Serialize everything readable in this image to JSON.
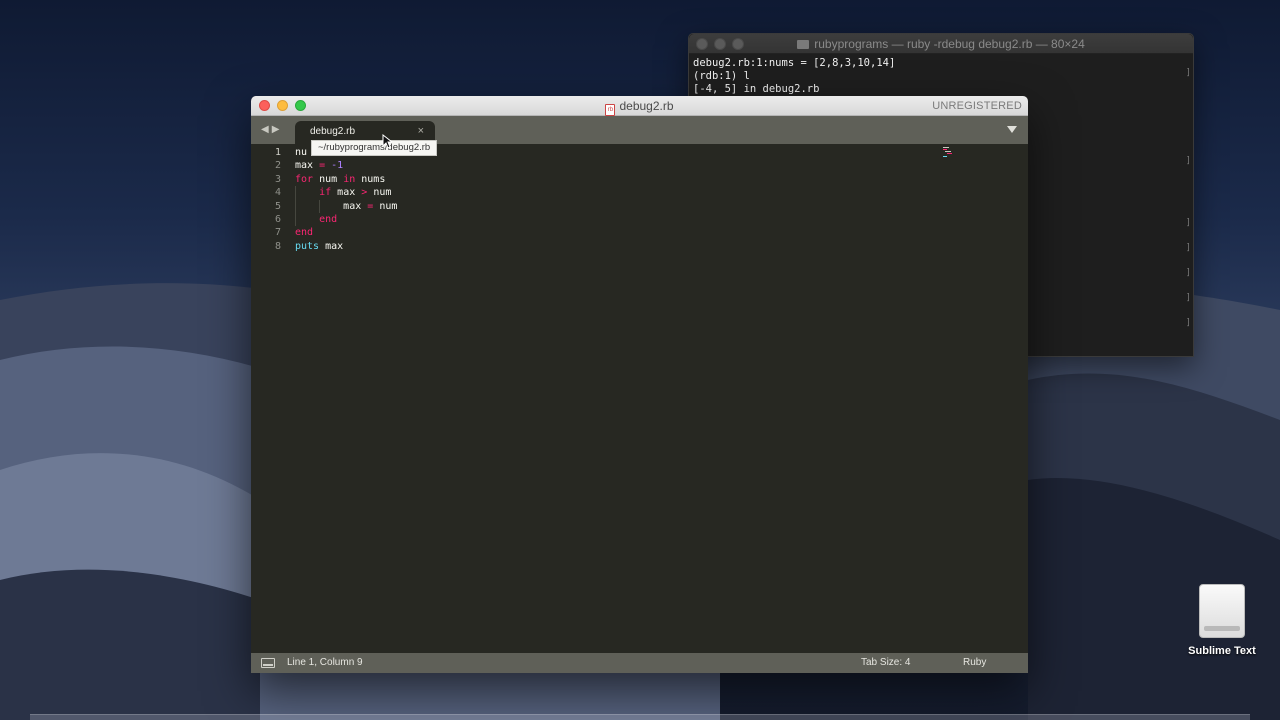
{
  "terminal": {
    "title": "rubyprograms — ruby -rdebug debug2.rb — 80×24",
    "lines": [
      "debug2.rb:1:nums = [2,8,3,10,14]",
      "(rdb:1) l",
      "[-4, 5] in debug2.rb"
    ]
  },
  "sublime": {
    "window_title": "debug2.rb",
    "unregistered": "UNREGISTERED",
    "tab": {
      "label": "debug2.rb",
      "close": "×"
    },
    "tooltip": "~/rubyprograms/debug2.rb",
    "gutter": [
      "1",
      "2",
      "3",
      "4",
      "5",
      "6",
      "7",
      "8"
    ],
    "status": {
      "position": "Line 1, Column 9",
      "tab_size": "Tab Size: 4",
      "syntax": "Ruby"
    }
  },
  "code": {
    "l1_a": "nu",
    "l2_a": "max",
    "l2_op": "=",
    "l2_num": "-1",
    "l3_kw": "for",
    "l3_var": "num",
    "l3_in": "in",
    "l3_iter": "nums",
    "l4_kw": "if",
    "l4_lhs": "max",
    "l4_op": ">",
    "l4_rhs": "num",
    "l5_lhs": "max",
    "l5_op": "=",
    "l5_rhs": "num",
    "l6_kw": "end",
    "l7_kw": "end",
    "l8_fn": "puts",
    "l8_arg": "max"
  },
  "desktop": {
    "drive_label": "Sublime Text"
  }
}
